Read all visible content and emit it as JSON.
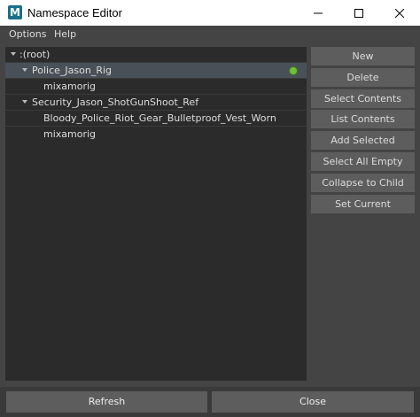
{
  "window": {
    "title": "Namespace Editor",
    "app_icon_letter": "M",
    "app_icon_color": "#1a6f8a"
  },
  "menu": {
    "items": [
      "Options",
      "Help"
    ]
  },
  "tree": {
    "rows": [
      {
        "label": ":(root)",
        "expanded": true,
        "selected": false,
        "depth": 0
      },
      {
        "label": "Police_Jason_Rig",
        "expanded": true,
        "selected": true,
        "depth": 1,
        "current": true
      },
      {
        "label": "mixamorig",
        "expanded": false,
        "selected": false,
        "depth": 2
      },
      {
        "label": "Security_Jason_ShotGunShoot_Ref",
        "expanded": true,
        "selected": false,
        "depth": 1
      },
      {
        "label": "Bloody_Police_Riot_Gear_Bulletproof_Vest_Worn",
        "expanded": false,
        "selected": false,
        "depth": 2
      },
      {
        "label": "mixamorig",
        "expanded": false,
        "selected": false,
        "depth": 2
      }
    ],
    "current_indicator_color": "#6fbf3c"
  },
  "side_buttons": [
    "New",
    "Delete",
    "Select Contents",
    "List Contents",
    "Add Selected",
    "Select All Empty",
    "Collapse to Child",
    "Set Current"
  ],
  "bottom_buttons": {
    "refresh": "Refresh",
    "close": "Close"
  }
}
